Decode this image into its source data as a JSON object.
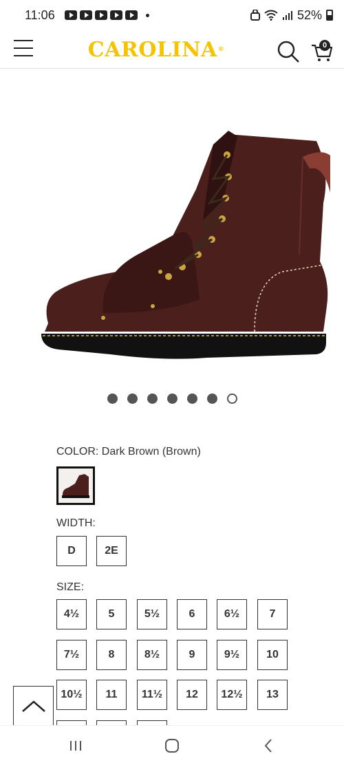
{
  "status_bar": {
    "time": "11:06",
    "battery": "52%",
    "icons": [
      "youtube-icon",
      "youtube-icon",
      "youtube-icon",
      "youtube-icon",
      "youtube-icon",
      "notification-dot",
      "vpn-icon",
      "wifi-icon",
      "signal-icon",
      "battery-icon"
    ]
  },
  "header": {
    "logo": "CAROLINA",
    "logo_mark": "®",
    "cart_count": "0",
    "icons": [
      "menu-icon",
      "search-icon",
      "cart-icon"
    ]
  },
  "product": {
    "image": "dark-brown-metguard-work-boot",
    "carousel": {
      "total": 7,
      "active_index": 6
    }
  },
  "color": {
    "label": "COLOR: Dark Brown (Brown)",
    "selected_swatch": "dark-brown-boot-swatch"
  },
  "width": {
    "label": "WIDTH:",
    "options": [
      "D",
      "2E"
    ]
  },
  "size": {
    "label": "SIZE:",
    "options": [
      "4½",
      "5",
      "5½",
      "6",
      "6½",
      "7",
      "7½",
      "8",
      "8½",
      "9",
      "9½",
      "10",
      "10½",
      "11",
      "11½",
      "12",
      "12½",
      "13"
    ]
  },
  "colors": {
    "brand_yellow": "#f4c400",
    "boot_brown": "#4a1f1c",
    "sole_black": "#111111"
  }
}
